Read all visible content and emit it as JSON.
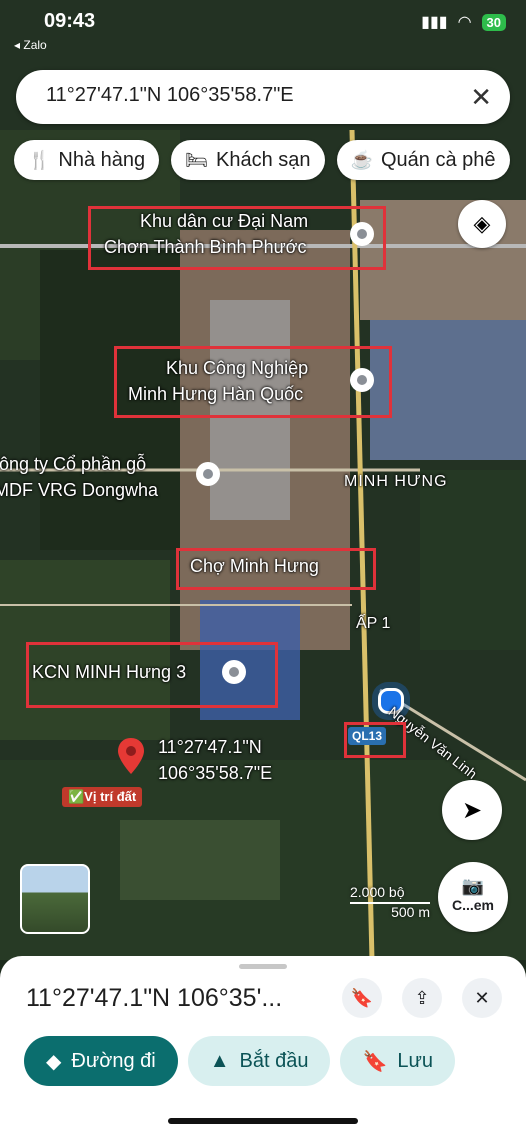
{
  "status": {
    "time": "09:43",
    "back_app": "◂ Zalo",
    "signal": "▮▮▮",
    "wifi": "wifi-icon",
    "battery": "30"
  },
  "search": {
    "query": "11°27'47.1\"N 106°35'58.7\"E",
    "clear_icon": "close-icon"
  },
  "chips": [
    {
      "icon": "restaurant-icon",
      "label": "Nhà hàng"
    },
    {
      "icon": "hotel-icon",
      "label": "Khách sạn"
    },
    {
      "icon": "cafe-icon",
      "label": "Quán cà phê"
    }
  ],
  "map": {
    "labels": {
      "dainam_1": "Khu dân cư Đại Nam",
      "dainam_2": "Chơn Thành Bình Phước",
      "kcn_1": "Khu Công Nghiệp",
      "kcn_2": "Minh Hưng Hàn Quốc",
      "dongwha_1": "Công ty Cổ phần gỗ",
      "dongwha_2": "MDF VRG Dongwha",
      "minhhung": "MINH HƯNG",
      "cho": "Chợ Minh Hưng",
      "ap1": "ẤP 1",
      "kcn3": "KCN MINH Hưng 3",
      "street": "Nguyễn Văn Linh",
      "ql13": "QL13",
      "coord_1": "11°27'47.1\"N",
      "coord_2": "106°35'58.7\"E",
      "vitri": "✅Vị trí đất"
    },
    "scale": {
      "ft": "2.000 bộ",
      "m": "500 m"
    },
    "camera_label": "C...em"
  },
  "sheet": {
    "title": "11°27'47.1\"N 106°35'...",
    "actions": [
      {
        "icon": "directions-icon",
        "label": "Đường đi"
      },
      {
        "icon": "navigation-icon",
        "label": "Bắt đầu"
      },
      {
        "icon": "bookmark-icon",
        "label": "Lưu"
      }
    ]
  },
  "colors": {
    "accent": "#0b6e6e",
    "secondary": "#d8efef",
    "highlight": "#e0323a"
  }
}
